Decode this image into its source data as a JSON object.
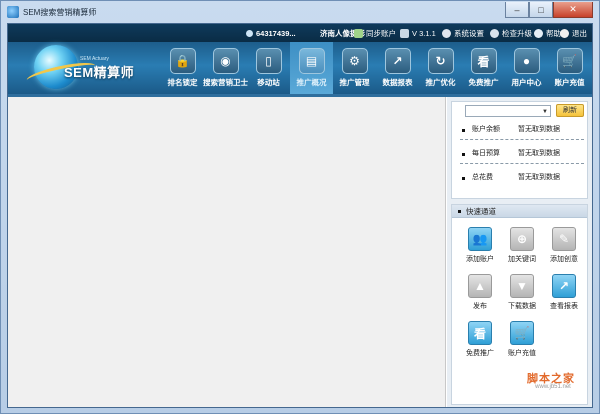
{
  "window": {
    "title": "SEM搜索营销精算师",
    "min_glyph": "–",
    "max_glyph": "□",
    "close_glyph": "✕"
  },
  "statusbar": {
    "user": "64317439...",
    "shop": "济南人像摄影",
    "items": [
      {
        "icon": "sync-icon",
        "label": "同步账户"
      },
      {
        "icon": "version-icon",
        "label": "V 3.1.1"
      },
      {
        "icon": "gear-icon",
        "label": "系统设置"
      },
      {
        "icon": "upgrade-icon",
        "label": "检查升级"
      },
      {
        "icon": "help-icon",
        "label": "帮助"
      },
      {
        "icon": "exit-icon",
        "label": "退出"
      }
    ]
  },
  "logo": {
    "name": "SEM精算师",
    "sub": "SEM Actuary"
  },
  "nav": [
    {
      "label": "排名锁定",
      "icon": "lock-icon",
      "glyph": "🔒"
    },
    {
      "label": "搜索营销卫士",
      "icon": "eye-icon",
      "glyph": "◉"
    },
    {
      "label": "移动站",
      "icon": "mobile-icon",
      "glyph": "▯"
    },
    {
      "label": "推广概况",
      "icon": "overview-icon",
      "glyph": "▤",
      "active": true
    },
    {
      "label": "推广管理",
      "icon": "gear-icon",
      "glyph": "⚙"
    },
    {
      "label": "数据报表",
      "icon": "chart-icon",
      "glyph": "↗"
    },
    {
      "label": "推广优化",
      "icon": "refresh-icon",
      "glyph": "↻"
    },
    {
      "label": "免费推广",
      "icon": "free-promo-icon",
      "glyph": "看"
    },
    {
      "label": "用户中心",
      "icon": "user-icon",
      "glyph": "●"
    },
    {
      "label": "账户充值",
      "icon": "cart-icon",
      "glyph": "🛒"
    }
  ],
  "account_panel": {
    "select_value": "",
    "refresh_label": "刷新",
    "rows": [
      {
        "label": "账户余额",
        "value": "暂无取到数据"
      },
      {
        "label": "每日预算",
        "value": "暂无取到数据"
      },
      {
        "label": "总花费",
        "value": "暂无取到数据"
      }
    ]
  },
  "quick_access": {
    "title": "快速通道",
    "items": [
      {
        "label": "添加账户",
        "icon": "add-account-icon",
        "glyph": "👥",
        "style": "blue"
      },
      {
        "label": "加关键词",
        "icon": "add-keyword-icon",
        "glyph": "⊕",
        "style": "gray"
      },
      {
        "label": "添加创意",
        "icon": "add-creative-icon",
        "glyph": "✎",
        "style": "gray"
      },
      {
        "label": "发布",
        "icon": "publish-icon",
        "glyph": "▲",
        "style": "gray"
      },
      {
        "label": "下载数据",
        "icon": "download-icon",
        "glyph": "▼",
        "style": "gray"
      },
      {
        "label": "查看报表",
        "icon": "report-icon",
        "glyph": "↗",
        "style": "blue"
      },
      {
        "label": "免费推广",
        "icon": "free-promo-icon",
        "glyph": "看",
        "style": "blue"
      },
      {
        "label": "账户充值",
        "icon": "cart-icon",
        "glyph": "🛒",
        "style": "blue"
      }
    ]
  },
  "watermark": {
    "text": "脚本之家",
    "url": "www.jb51.net"
  }
}
